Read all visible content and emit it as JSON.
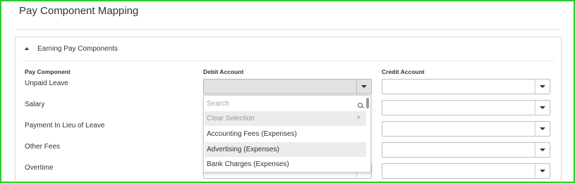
{
  "page": {
    "title": "Pay Component Mapping"
  },
  "panel": {
    "title": "Earning Pay Components"
  },
  "columns": {
    "pay_component": "Pay Component",
    "debit": "Debit Account",
    "credit": "Credit Account"
  },
  "rows": [
    {
      "label": "Unpaid Leave",
      "debit": "",
      "credit": ""
    },
    {
      "label": "Salary",
      "debit": "",
      "credit": ""
    },
    {
      "label": "Payment In Lieu of Leave",
      "debit": "",
      "credit": ""
    },
    {
      "label": "Other Fees",
      "debit": "",
      "credit": ""
    },
    {
      "label": "Overtime",
      "debit": "",
      "credit": ""
    }
  ],
  "dropdown": {
    "search_placeholder": "Search",
    "clear_label": "Clear Selection",
    "clear_icon": "×",
    "options": [
      "Accounting Fees (Expenses)",
      "Advertising (Expenses)",
      "Bank Charges (Expenses)"
    ],
    "hovered_option": "Advertising (Expenses)"
  }
}
